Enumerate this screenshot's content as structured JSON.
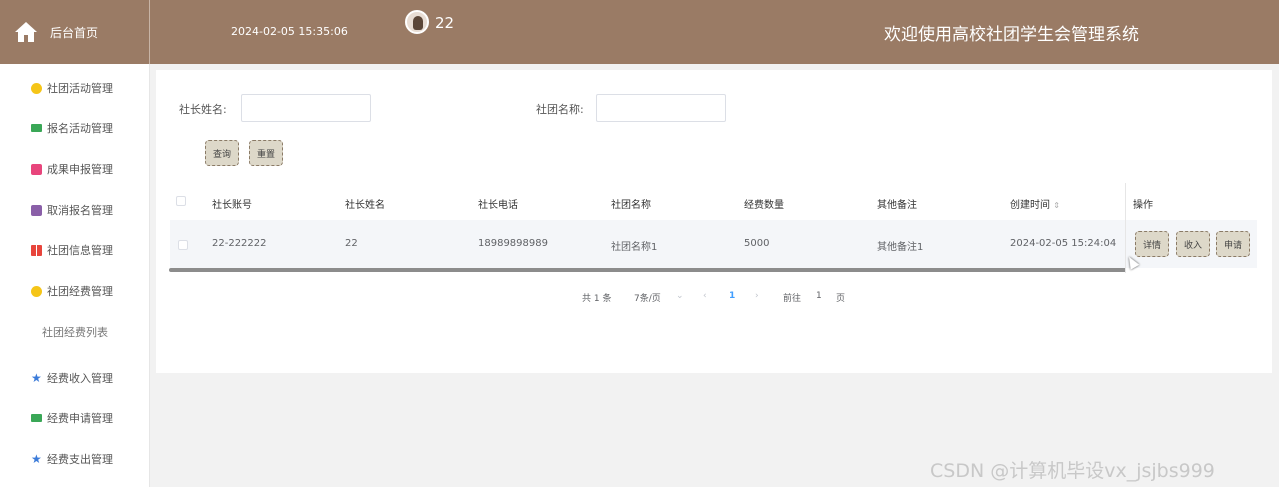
{
  "header": {
    "home_label": "后台首页",
    "datetime": "2024-02-05 15:35:06",
    "username": "22",
    "system_title": "欢迎使用高校社团学生会管理系统",
    "bg_color": "#9a7b65"
  },
  "sidebar": {
    "items": [
      {
        "label": "社团活动管理",
        "icon": "circle-icon"
      },
      {
        "label": "报名活动管理",
        "icon": "chat-icon"
      },
      {
        "label": "成果申报管理",
        "icon": "doc-icon"
      },
      {
        "label": "取消报名管理",
        "icon": "list-icon"
      },
      {
        "label": "社团信息管理",
        "icon": "grid-icon"
      },
      {
        "label": "社团经费管理",
        "icon": "circle-icon"
      },
      {
        "label": "社团经费列表",
        "icon": ""
      },
      {
        "label": "经费收入管理",
        "icon": "star-icon"
      },
      {
        "label": "经费申请管理",
        "icon": "chat-icon"
      },
      {
        "label": "经费支出管理",
        "icon": "star-icon"
      }
    ]
  },
  "search": {
    "leader_name_label": "社长姓名:",
    "leader_name_value": "",
    "club_name_label": "社团名称:",
    "club_name_value": "",
    "query_button": "查询",
    "reset_button": "重置"
  },
  "table": {
    "columns": [
      "社长账号",
      "社长姓名",
      "社长电话",
      "社团名称",
      "经费数量",
      "其他备注",
      "创建时间",
      "操作"
    ],
    "sort_icon": "⇕",
    "rows": [
      {
        "account": "22-222222",
        "name": "22",
        "phone": "18989898989",
        "club": "社团名称1",
        "amount": "5000",
        "remark": "其他备注1",
        "created": "2024-02-05 15:24:04",
        "actions": [
          "详情",
          "收入",
          "申请"
        ]
      }
    ]
  },
  "pagination": {
    "total": "共 1 条",
    "page_size": "7条/页",
    "prev": "‹",
    "current": "1",
    "next": "›",
    "goto_label": "前往",
    "goto_value": "1",
    "page_suffix": "页"
  },
  "watermark": "CSDN @计算机毕设vx_jsjbs999"
}
